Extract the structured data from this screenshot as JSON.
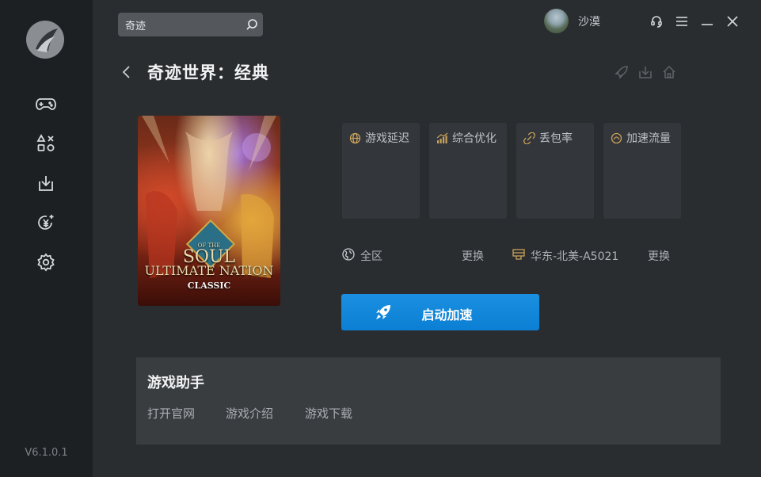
{
  "search": {
    "value": "奇迹"
  },
  "user": {
    "name": "沙漠"
  },
  "version": "V6.1.0.1",
  "game": {
    "title": "奇迹世界：经典"
  },
  "cover": {
    "line_top": "OF THE",
    "line1": "SOUL",
    "line2": "ULTIMATE NATION",
    "line3": "CLASSIC"
  },
  "stats": [
    {
      "label": "游戏延迟",
      "icon": "globe-icon"
    },
    {
      "label": "综合优化",
      "icon": "signal-bars-icon"
    },
    {
      "label": "丢包率",
      "icon": "broken-link-icon"
    },
    {
      "label": "加速流量",
      "icon": "flow-icon"
    }
  ],
  "region": {
    "value": "全区",
    "change": "更换"
  },
  "node": {
    "value": "华东-北美-A5021",
    "change": "更换"
  },
  "start_button": "启动加速",
  "assistant": {
    "title": "游戏助手",
    "links": [
      "打开官网",
      "游戏介绍",
      "游戏下载"
    ]
  },
  "colors": {
    "accent": "#0b83d6",
    "stat_icon": "#c9a15a"
  }
}
